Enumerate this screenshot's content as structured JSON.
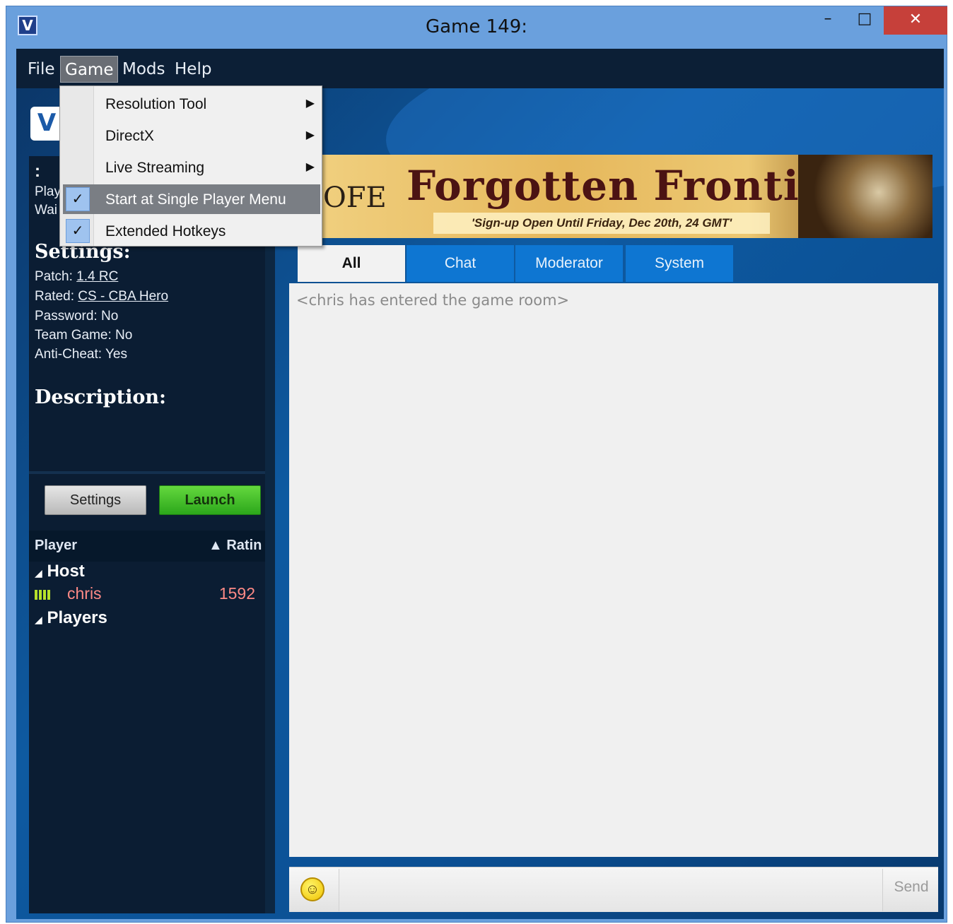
{
  "window": {
    "title": "Game 149:",
    "icon_letter": "V",
    "minimize_glyph": "–",
    "maximize_glyph": "□",
    "close_glyph": "✕"
  },
  "menubar": {
    "items": [
      "File",
      "Game",
      "Mods",
      "Help"
    ],
    "active": "Game"
  },
  "game_menu": {
    "items": [
      {
        "label": "Resolution Tool",
        "submenu": true,
        "checked": false
      },
      {
        "label": "DirectX",
        "submenu": true,
        "checked": false
      },
      {
        "label": "Live Streaming",
        "submenu": true,
        "checked": false
      },
      {
        "label": "Start at Single Player Menu",
        "submenu": false,
        "checked": true,
        "highlighted": true
      },
      {
        "label": "Extended Hotkeys",
        "submenu": false,
        "checked": true
      }
    ],
    "arrow_glyph": "▶",
    "check_glyph": "✓"
  },
  "left_panel": {
    "logo_letter": "V",
    "colon": ":",
    "play_text": "Play",
    "wait_text": "Wai",
    "settings_heading": "Settings:",
    "settings": {
      "patch_label": "Patch:",
      "patch_value": "1.4 RC",
      "rated_label": "Rated:",
      "rated_value": "CS - CBA Hero",
      "password": "Password: No",
      "team_game": "Team Game: No",
      "anti_cheat": "Anti-Cheat: Yes"
    },
    "description_heading": "Description:",
    "buttons": {
      "settings": "Settings",
      "launch": "Launch"
    },
    "player_list": {
      "col_player": "Player",
      "col_rating": "▲ Ratin",
      "groups": [
        {
          "name": "Host",
          "players": [
            {
              "name": "chris",
              "rating": "1592"
            }
          ]
        },
        {
          "name": "Players",
          "players": []
        }
      ],
      "expand_glyph": "◢"
    }
  },
  "banner": {
    "ofe": "OFE",
    "title": "Forgotten Frontiers",
    "subtitle": "'Sign-up Open Until Friday, Dec 20th, 24 GMT'"
  },
  "tabs": [
    "All",
    "Chat",
    "Moderator",
    "System"
  ],
  "active_tab": "All",
  "chat": {
    "messages": [
      "<chris has entered the game room>"
    ],
    "input_value": "",
    "send_label": "Send",
    "emoji_glyph": "☺"
  },
  "colors": {
    "accent_tab": "#0e76d2",
    "launch_green": "#2ca71b",
    "host_name": "#ff8a86",
    "close_red": "#c6403a"
  }
}
